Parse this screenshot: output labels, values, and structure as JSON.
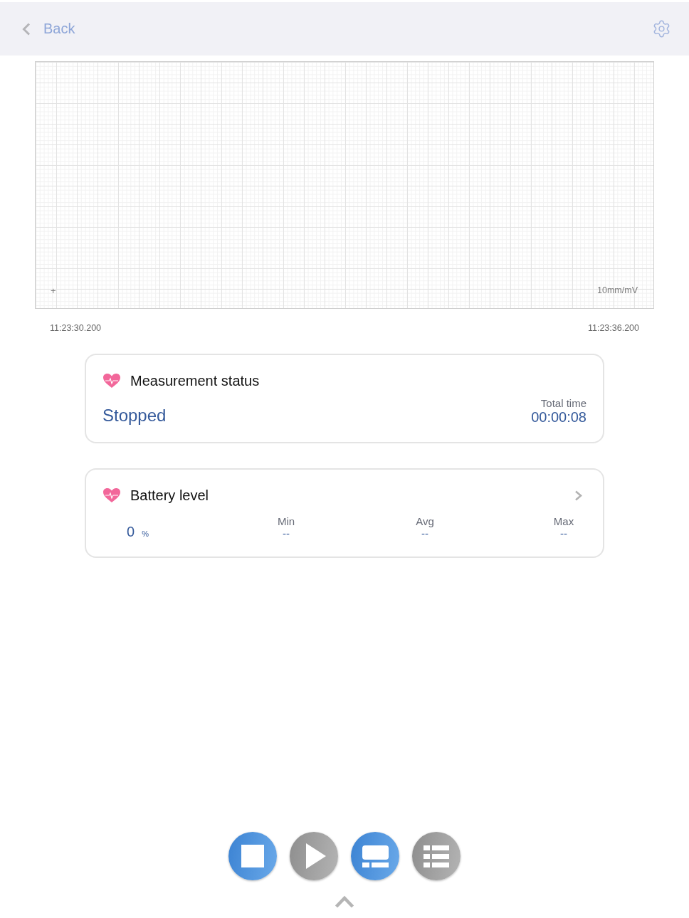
{
  "nav": {
    "back_label": "Back"
  },
  "ecg": {
    "marker": "+",
    "scale": "10mm/mV",
    "start_time": "11:23:30.200",
    "end_time": "11:23:36.200"
  },
  "cards": [
    {
      "kind": "status",
      "title": "Measurement status",
      "navigable": false,
      "status": "Stopped",
      "total_label": "Total time",
      "total_value": "00:00:08"
    },
    {
      "kind": "stats",
      "title": "Battery level",
      "navigable": true,
      "value": "0",
      "unit": "%",
      "stats": [
        {
          "label": "Min",
          "value": "--"
        },
        {
          "label": "Avg",
          "value": "--"
        },
        {
          "label": "Max",
          "value": "--"
        }
      ]
    }
  ],
  "controls": [
    {
      "kind": "stop",
      "active": true
    },
    {
      "kind": "play",
      "active": false
    },
    {
      "kind": "display",
      "active": true
    },
    {
      "kind": "list",
      "active": false
    }
  ]
}
